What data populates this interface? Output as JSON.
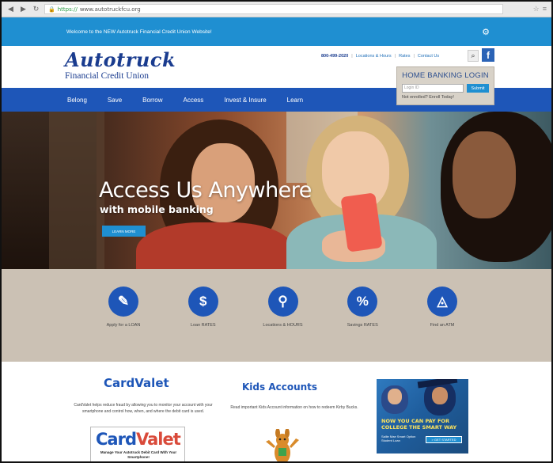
{
  "browser": {
    "url_scheme": "https://",
    "url_host": "www.autotruckfcu.org"
  },
  "welcome": {
    "text": "Welcome to the NEW Autotruck Financial Credit Union Website!"
  },
  "logo": {
    "name": "Autotruck",
    "sub": "Financial Credit Union"
  },
  "header": {
    "phone": "800-499-2020",
    "links": [
      "Locations & Hours",
      "Rates",
      "Contact Us"
    ]
  },
  "home_banking": {
    "title": "HOME BANKING LOGIN",
    "input_placeholder": "Login ID",
    "button": "Submit",
    "enroll": "Not enrolled? Enroll Today!"
  },
  "nav": {
    "items": [
      "Belong",
      "Save",
      "Borrow",
      "Access",
      "Invest & Insure",
      "Learn"
    ]
  },
  "hero": {
    "title": "Access Us Anywhere",
    "subtitle": "with mobile banking",
    "button": "LEARN MORE"
  },
  "quick_links": [
    {
      "label": "Apply for a LOAN",
      "icon": "edit-icon",
      "glyph": "✎"
    },
    {
      "label": "Loan RATES",
      "icon": "dollar-icon",
      "glyph": "$"
    },
    {
      "label": "Locations & HOURS",
      "icon": "location-pin-icon",
      "glyph": "⚲"
    },
    {
      "label": "Savings RATES",
      "icon": "percent-icon",
      "glyph": "%"
    },
    {
      "label": "Find an ATM",
      "icon": "atm-icon",
      "glyph": "◬"
    }
  ],
  "cardvalet": {
    "title": "CardValet",
    "text": "CardValet helps reduce fraud by allowing you to monitor your account with your smartphone and control how, when, and where the debit card is used.",
    "logo_card": "Card",
    "logo_valet": "Valet",
    "logo_tag": "Manage Your Autotruck Debit Card With Your Smartphone!"
  },
  "kids": {
    "title": "Kids Accounts",
    "text": "Read important Kids Account information on how to redeem Kirby Bucks."
  },
  "ad": {
    "headline": "NOW YOU CAN PAY FOR COLLEGE THE SMART WAY",
    "small": "Sallie Mae Smart Option Student Loan",
    "button": "> GET STARTED"
  },
  "colors": {
    "accent_blue": "#1f8fd1",
    "nav_blue": "#1e56b8",
    "quick_links_bg": "#cbc1b4"
  }
}
